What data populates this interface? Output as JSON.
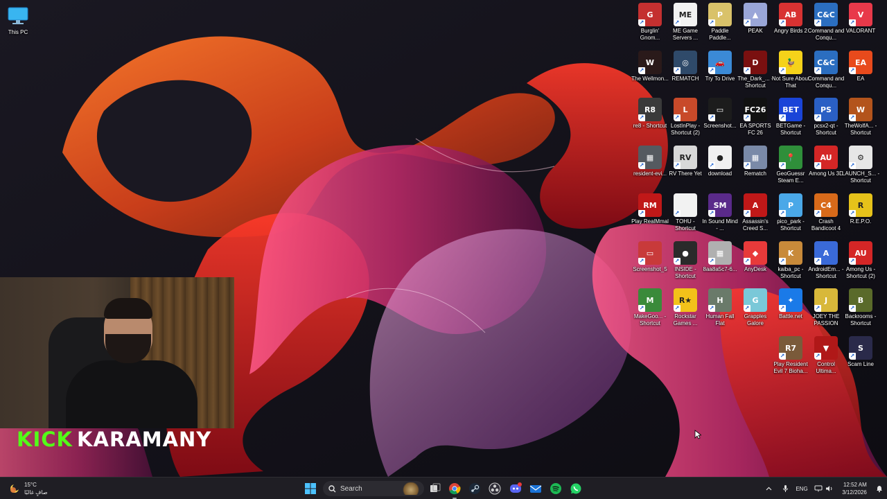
{
  "desktop": {
    "this_pc": {
      "label": "This PC",
      "icon": "monitor-icon"
    },
    "icons": [
      {
        "label": "Burglin' Gnom...",
        "icon": "gnome-icon",
        "color": "#c43030",
        "glyph": "G"
      },
      {
        "label": "ME Game Servers ...",
        "icon": "server-grid-icon",
        "color": "#f2f2f2",
        "glyph": "ME"
      },
      {
        "label": "Paddle Paddle...",
        "icon": "paddle-icon",
        "color": "#d9c26a",
        "glyph": "P"
      },
      {
        "label": "PEAK",
        "icon": "mountain-icon",
        "color": "#9aa6d8",
        "glyph": "▲"
      },
      {
        "label": "Angry Birds 2",
        "icon": "angry-bird-icon",
        "color": "#d83232",
        "glyph": "AB"
      },
      {
        "label": "Command and Conqu...",
        "icon": "eagle-icon",
        "color": "#2b6ec0",
        "glyph": "C&C"
      },
      {
        "label": "VALORANT",
        "icon": "valorant-icon",
        "color": "#e8394a",
        "glyph": "V"
      },
      {
        "label": "The Wellmon...",
        "icon": "game-icon",
        "color": "#2a1a1a",
        "glyph": "W"
      },
      {
        "label": "REMATCH",
        "icon": "ball-icon",
        "color": "#2f4a6a",
        "glyph": "◎"
      },
      {
        "label": "Try To Drive",
        "icon": "car-icon",
        "color": "#3b8ad6",
        "glyph": "🚗"
      },
      {
        "label": "The_Dark_... - Shortcut",
        "icon": "dark-icon",
        "color": "#7a1010",
        "glyph": "D"
      },
      {
        "label": "Not Sure About That",
        "icon": "duck-icon",
        "color": "#f5d21a",
        "glyph": "🦆"
      },
      {
        "label": "Command and Conqu...",
        "icon": "eagle-icon",
        "color": "#2b6ec0",
        "glyph": "C&C"
      },
      {
        "label": "EA",
        "icon": "ea-icon",
        "color": "#e84a1c",
        "glyph": "EA"
      },
      {
        "label": "re8 - Shortcut",
        "icon": "re8-icon",
        "color": "#3a3a3a",
        "glyph": "R8"
      },
      {
        "label": "LostInPlay - Shortcut (2)",
        "icon": "lostinplay-icon",
        "color": "#c84a2a",
        "glyph": "L"
      },
      {
        "label": "Screenshot...",
        "icon": "screenshot-icon",
        "color": "#1c1c1c",
        "glyph": "▭"
      },
      {
        "label": "EA SPORTS FC 26",
        "icon": "fc26-icon",
        "color": "#111",
        "glyph": "FC26"
      },
      {
        "label": "BETGame - Shortcut",
        "icon": "bet-icon",
        "color": "#1a44d8",
        "glyph": "BET"
      },
      {
        "label": "pcsx2-qt - Shortcut",
        "icon": "pcsx2-icon",
        "color": "#2a5fc4",
        "glyph": "PS"
      },
      {
        "label": "TheWolfA... - Shortcut",
        "icon": "wolf-icon",
        "color": "#b3541c",
        "glyph": "W"
      },
      {
        "label": "resident-evi...",
        "icon": "photo-icon",
        "color": "#555a60",
        "glyph": "▦"
      },
      {
        "label": "RV There Yet",
        "icon": "rv-icon",
        "color": "#d8d8d8",
        "glyph": "RV"
      },
      {
        "label": "download",
        "icon": "photo-icon",
        "color": "#f0f0f0",
        "glyph": "●"
      },
      {
        "label": "Rematch",
        "icon": "photo-icon",
        "color": "#7a8aa8",
        "glyph": "▦"
      },
      {
        "label": "GeoGuessr Steam E...",
        "icon": "map-pin-icon",
        "color": "#2f8f3a",
        "glyph": "📍"
      },
      {
        "label": "Among Us 3D",
        "icon": "crewmate-icon",
        "color": "#d42626",
        "glyph": "AU"
      },
      {
        "label": "LAUNCH_S... - Shortcut",
        "icon": "gear-icon",
        "color": "#e6e6e6",
        "glyph": "⚙"
      },
      {
        "label": "Play RealMmal",
        "icon": "realmmal-icon",
        "color": "#c01818",
        "glyph": "RM"
      },
      {
        "label": "TOHU - Shortcut",
        "icon": "file-icon",
        "color": "#f2f2f2",
        "glyph": " "
      },
      {
        "label": "In Sound Mind - ...",
        "icon": "sound-mind-icon",
        "color": "#5a2a8a",
        "glyph": "SM"
      },
      {
        "label": "Assassin's Creed S...",
        "icon": "assassin-icon",
        "color": "#c01818",
        "glyph": "A"
      },
      {
        "label": "pico_park - Shortcut",
        "icon": "pico-icon",
        "color": "#4aa8e8",
        "glyph": "P"
      },
      {
        "label": "Crash Bandicoot 4",
        "icon": "crash-icon",
        "color": "#d86a1a",
        "glyph": "C4"
      },
      {
        "label": "R.E.P.O.",
        "icon": "repo-icon",
        "color": "#e6c21a",
        "glyph": "R"
      },
      {
        "label": "Screenshot_5",
        "icon": "screenshot-icon",
        "color": "#c83a3a",
        "glyph": "▭"
      },
      {
        "label": "INSIDE - Shortcut",
        "icon": "inside-icon",
        "color": "#2a2a2a",
        "glyph": "●"
      },
      {
        "label": "8aa8a5c7-6...",
        "icon": "photo-icon",
        "color": "#b0b0b0",
        "glyph": "▦"
      },
      {
        "label": "AnyDesk",
        "icon": "anydesk-icon",
        "color": "#e83a3a",
        "glyph": "◆"
      },
      {
        "label": "kaiba_pc - Shortcut",
        "icon": "kaiba-icon",
        "color": "#c88a3a",
        "glyph": "K"
      },
      {
        "label": "AndroidEm... - Shortcut",
        "icon": "android-icon",
        "color": "#3a6ad8",
        "glyph": "A"
      },
      {
        "label": "Among Us - Shortcut (2)",
        "icon": "crewmate-icon",
        "color": "#d42626",
        "glyph": "AU"
      },
      {
        "label": "MakeGoo... - Shortcut",
        "icon": "makegoo-icon",
        "color": "#3a8a3a",
        "glyph": "M"
      },
      {
        "label": "Rockstar Games ...",
        "icon": "rockstar-icon",
        "color": "#f2c21a",
        "glyph": "R★"
      },
      {
        "label": "Human Fall Flat",
        "icon": "human-icon",
        "color": "#6a7a6a",
        "glyph": "H"
      },
      {
        "label": "Grapples Galore",
        "icon": "grapple-icon",
        "color": "#7ac8d8",
        "glyph": "G"
      },
      {
        "label": "Battle.net",
        "icon": "battlenet-icon",
        "color": "#1a7ae8",
        "glyph": "✦"
      },
      {
        "label": "JOEY THE PASSION",
        "icon": "joey-icon",
        "color": "#d8b83a",
        "glyph": "J"
      },
      {
        "label": "Backrooms - Shortcut",
        "icon": "backrooms-icon",
        "color": "#5a6a2a",
        "glyph": "B"
      },
      {
        "label": "Play Resident Evil 7 Bioha...",
        "icon": "re7-icon",
        "color": "#7a5a3a",
        "glyph": "R7"
      },
      {
        "label": "Control Ultima...",
        "icon": "control-icon",
        "color": "#b01818",
        "glyph": "▼"
      },
      {
        "label": "Scam Line",
        "icon": "scamline-icon",
        "color": "#2a2a4a",
        "glyph": "S"
      }
    ]
  },
  "stream": {
    "kick": "KICK",
    "name": "KARAMANY"
  },
  "taskbar": {
    "weather": {
      "temp": "15°C",
      "condition": "صافٍ غالبًا"
    },
    "search_placeholder": "Search",
    "apps": [
      {
        "name": "start-button",
        "icon": "windows-icon"
      },
      {
        "name": "task-view-button",
        "icon": "task-view-icon"
      },
      {
        "name": "chrome-button",
        "icon": "chrome-icon",
        "active": true
      },
      {
        "name": "steam-button",
        "icon": "steam-icon"
      },
      {
        "name": "obs-button",
        "icon": "obs-icon"
      },
      {
        "name": "discord-button",
        "icon": "discord-icon"
      },
      {
        "name": "mail-button",
        "icon": "mail-icon"
      },
      {
        "name": "spotify-button",
        "icon": "spotify-icon"
      },
      {
        "name": "whatsapp-button",
        "icon": "whatsapp-icon"
      }
    ],
    "tray": {
      "language": "ENG",
      "time": "12:52 AM",
      "date": "3/12/2026"
    }
  },
  "colors": {
    "kick_green": "#53fc18",
    "taskbar_bg": "#1f1e24"
  }
}
